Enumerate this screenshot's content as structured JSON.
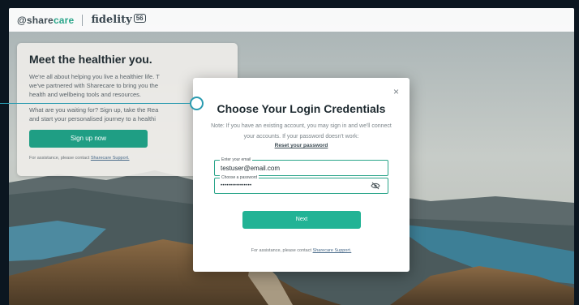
{
  "header": {
    "brand_sharecare_prefix": "@share",
    "brand_sharecare_suffix": "care",
    "brand_fidelity": "fidelity",
    "brand_badge": "56"
  },
  "left_card": {
    "title": "Meet the healthier you.",
    "paragraph1": "We're all about helping you live a healthier life. T\nwe've partnered with Sharecare to bring you the\nhealth and wellbeing tools and resources.",
    "paragraph2": "What are you waiting for? Sign up, take the Rea\nand start your personalised journey to a healthi",
    "signup_label": "Sign up now",
    "assist_prefix": "For assistance, please contact ",
    "assist_link": "Sharecare Support."
  },
  "modal": {
    "close_glyph": "×",
    "title": "Choose Your Login Credentials",
    "note": "Note: If you have an existing account, you may sign in and we'll connect your accounts. If your password doesn't work:",
    "reset_link": "Reset your password",
    "email_label": "Enter your email",
    "email_value": "testuser@email.com",
    "password_label": "Choose a password",
    "password_value": "••••••••••••••••",
    "password_icon": "eye-slash-icon",
    "next_label": "Next",
    "assist_prefix": "For assistance, please contact ",
    "assist_link": "Sharecare Support."
  },
  "colors": {
    "accent": "#22b395",
    "pointer": "#2a9bb0"
  }
}
